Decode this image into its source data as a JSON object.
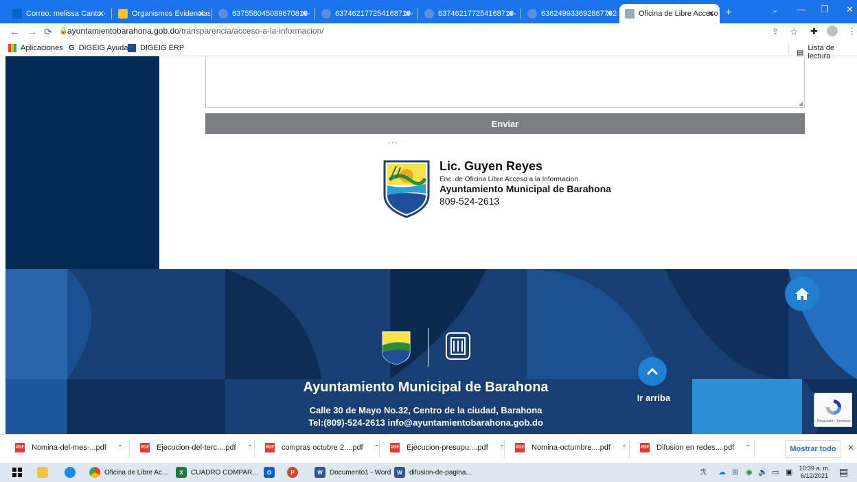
{
  "browser": {
    "tabs": [
      {
        "title": "Correo: melissa Canto -",
        "active": false
      },
      {
        "title": "Organismos Evidencias",
        "active": false
      },
      {
        "title": "637558045089670819-",
        "active": false
      },
      {
        "title": "637462177254168719-",
        "active": false
      },
      {
        "title": "637462177254168719-",
        "active": false
      },
      {
        "title": "636249933692867792-",
        "active": false
      },
      {
        "title": "Oficina de Libre Acceso",
        "active": true
      }
    ],
    "url_domain": "ayuntamientobarahona.gob.do",
    "url_path": "/transparencia/acceso-a-la-informacion/",
    "bookmarks": [
      "Aplicaciones",
      "DIGEIG Ayuda",
      "DIGEIG ERP"
    ],
    "reading_list": "Lista de lectura"
  },
  "form": {
    "submit_label": "Enviar"
  },
  "signature": {
    "name": "Lic. Guyen Reyes",
    "role": "Enc. de Oficina Libre Acceso a la Informacion",
    "org": "Ayuntamiento Municipal de Barahona",
    "phone": "809-524-2613"
  },
  "footer": {
    "title": "Ayuntamiento Municipal de Barahona",
    "address": "Calle 30 de Mayo No.32, Centro de la ciudad, Barahona",
    "contact": "Tel:(809)-524-2613 info@ayuntamientobarahona.gob.do",
    "scroll_top_label": "Ir arriba",
    "recaptcha_text": "Privacidad - Términos"
  },
  "downloads": {
    "items": [
      "Nomina-del-mes-...pdf",
      "Ejecucion-del-terc....pdf",
      "compras octubre 2....pdf",
      "Ejecucion-presupu....pdf",
      "Nomina-octumbre....pdf",
      "Difusion en redes....pdf"
    ],
    "show_all": "Mostrar todo"
  },
  "taskbar": {
    "apps": [
      "Oficina de Libre Ac...",
      "CUADRO COMPAR...",
      "Documento1 - Word",
      "difusion-de-pagina..."
    ],
    "time": "10:39 a. m.",
    "date": "6/12/2021"
  },
  "colors": {
    "chrome_blue": "#1a73e8",
    "sidebar_navy": "#002b55",
    "footer_navy": "#173f72",
    "accent_blue": "#1f7fd0",
    "button_gray": "#7b7f83"
  }
}
